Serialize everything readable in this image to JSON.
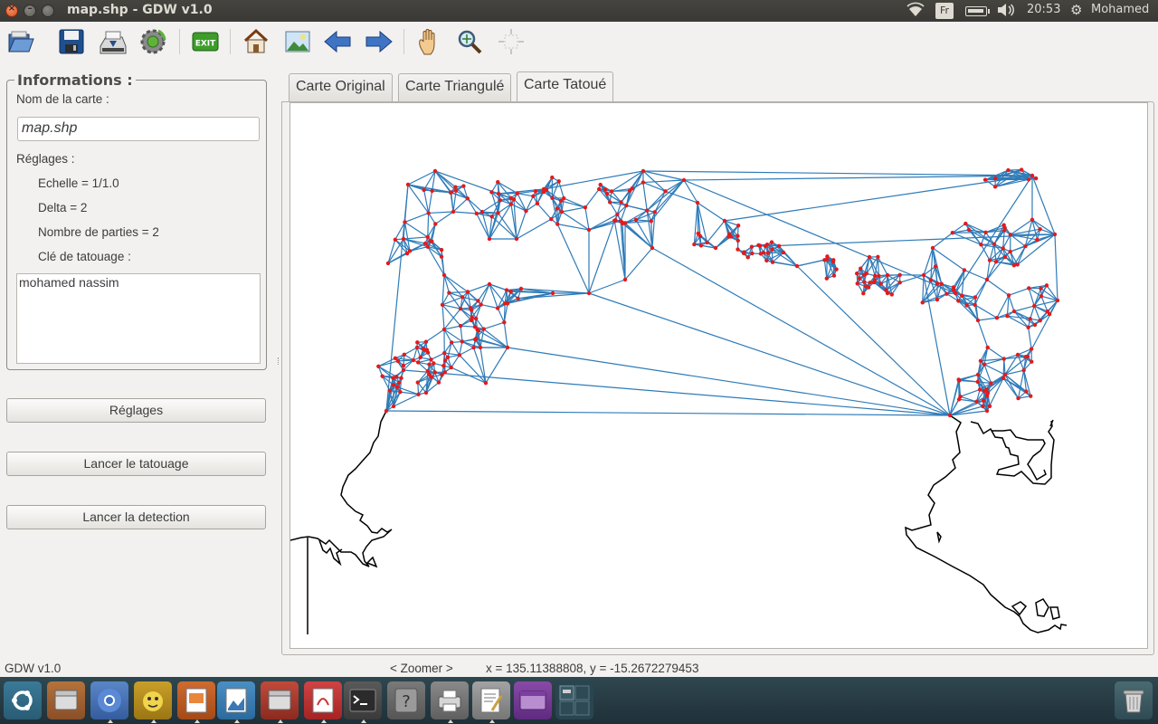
{
  "window": {
    "title": "map.shp - GDW v1.0",
    "close_glyph": "×",
    "min_glyph": "–"
  },
  "tray": {
    "language": "Fr",
    "clock": "20:53",
    "user": "Mohamed"
  },
  "toolbar": {
    "items": [
      {
        "name": "open-icon"
      },
      {
        "name": "save-icon"
      },
      {
        "name": "scanner-icon"
      },
      {
        "name": "settings-icon"
      },
      {
        "name": "exit-icon",
        "label": "EXIT"
      },
      {
        "name": "home-icon"
      },
      {
        "name": "image-icon"
      },
      {
        "name": "back-arrow-icon"
      },
      {
        "name": "forward-arrow-icon"
      },
      {
        "name": "pan-hand-icon"
      },
      {
        "name": "zoom-icon"
      },
      {
        "name": "fit-extent-icon"
      }
    ]
  },
  "info": {
    "title": "Informations :",
    "map_name_label": "Nom de la carte :",
    "map_name_value": "map.shp",
    "settings_label": "Réglages :",
    "scale": "Echelle = 1/1.0",
    "delta": "Delta = 2",
    "parts": "Nombre de parties = 2",
    "key_label": "Clé de tatouage :",
    "key_value": "mohamed nassim"
  },
  "buttons": {
    "settings": "Réglages",
    "watermark": "Lancer le tatouage",
    "detect": "Lancer la detection"
  },
  "tabs": [
    {
      "label": "Carte Original",
      "active": false
    },
    {
      "label": "Carte Triangulé",
      "active": false
    },
    {
      "label": "Carte Tatoué",
      "active": true
    }
  ],
  "colors": {
    "edge": "#2e7bb8",
    "vertex": "#e41a1c",
    "coastline": "#000000"
  },
  "status": {
    "app": "GDW v1.0",
    "mode": "< Zoomer >",
    "coords": "x = 135.11388808,  y = -15.2672279453"
  },
  "dock": {
    "items": [
      {
        "name": "ubuntu-dash-icon"
      },
      {
        "name": "files-icon"
      },
      {
        "name": "chromium-icon"
      },
      {
        "name": "python-idle-icon"
      },
      {
        "name": "impress-icon"
      },
      {
        "name": "image-viewer-icon"
      },
      {
        "name": "file-manager-icon"
      },
      {
        "name": "pdf-viewer-icon"
      },
      {
        "name": "terminal-icon"
      },
      {
        "name": "help-icon"
      },
      {
        "name": "printer-icon"
      },
      {
        "name": "text-editor-icon"
      },
      {
        "name": "app-window-icon"
      },
      {
        "name": "workspace-switcher-icon"
      },
      {
        "name": "trash-icon"
      }
    ]
  }
}
